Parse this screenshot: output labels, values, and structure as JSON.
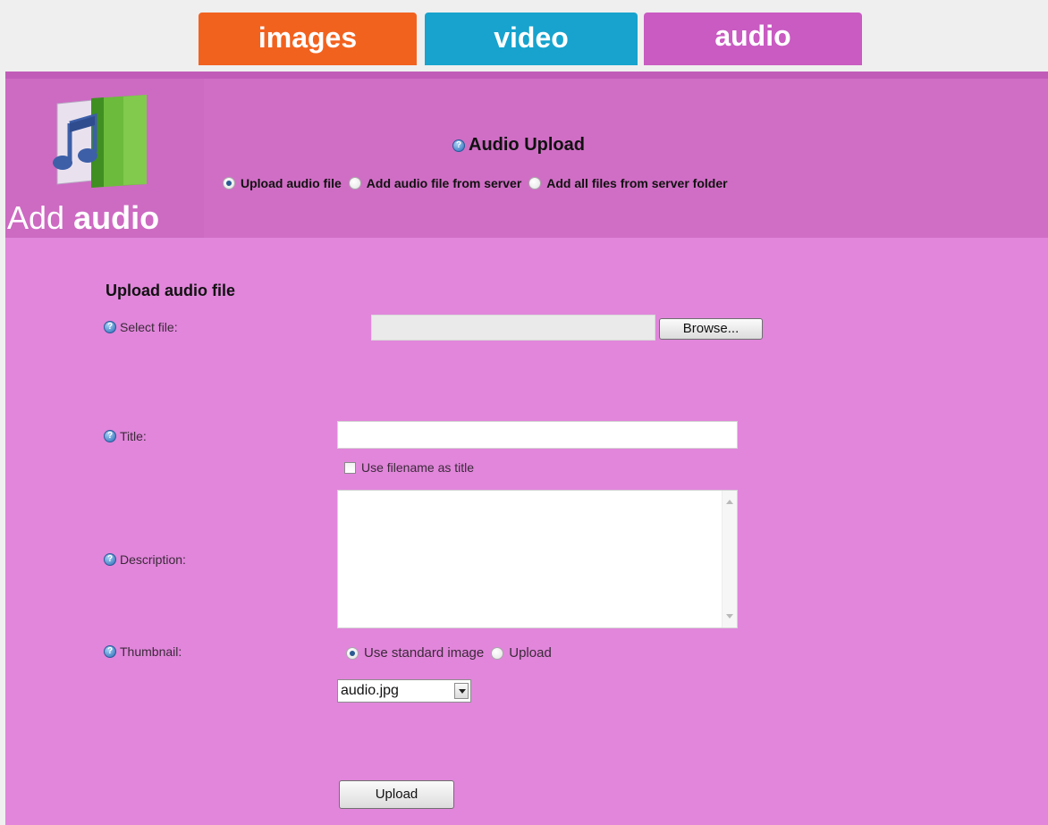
{
  "tabs": [
    {
      "label": "images"
    },
    {
      "label": "video"
    },
    {
      "label": "audio"
    }
  ],
  "colors": {
    "tab_images": "#f2621f",
    "tab_video": "#17a3cd",
    "tab_audio": "#c95bc2",
    "header_bg": "#d06ec5",
    "form_bg": "#e186db"
  },
  "logo": {
    "prefix": "Add",
    "word": "audio",
    "icon": "audio-book-music-note-icon"
  },
  "upload_heading": "Audio Upload",
  "modes": [
    {
      "label": "Upload audio file",
      "selected": true
    },
    {
      "label": "Add audio file from server",
      "selected": false
    },
    {
      "label": "Add all files from server folder",
      "selected": false
    }
  ],
  "form": {
    "section_title": "Upload audio file",
    "select_file_label": "Select file:",
    "browse_label": "Browse...",
    "title_label": "Title:",
    "title_value": "",
    "use_filename_label": "Use filename as title",
    "use_filename_checked": false,
    "description_label": "Description:",
    "description_value": "",
    "thumbnail_label": "Thumbnail:",
    "thumbnail_options": [
      {
        "label": "Use standard image",
        "selected": true
      },
      {
        "label": "Upload",
        "selected": false
      }
    ],
    "thumbnail_select_value": "audio.jpg",
    "upload_button": "Upload"
  }
}
